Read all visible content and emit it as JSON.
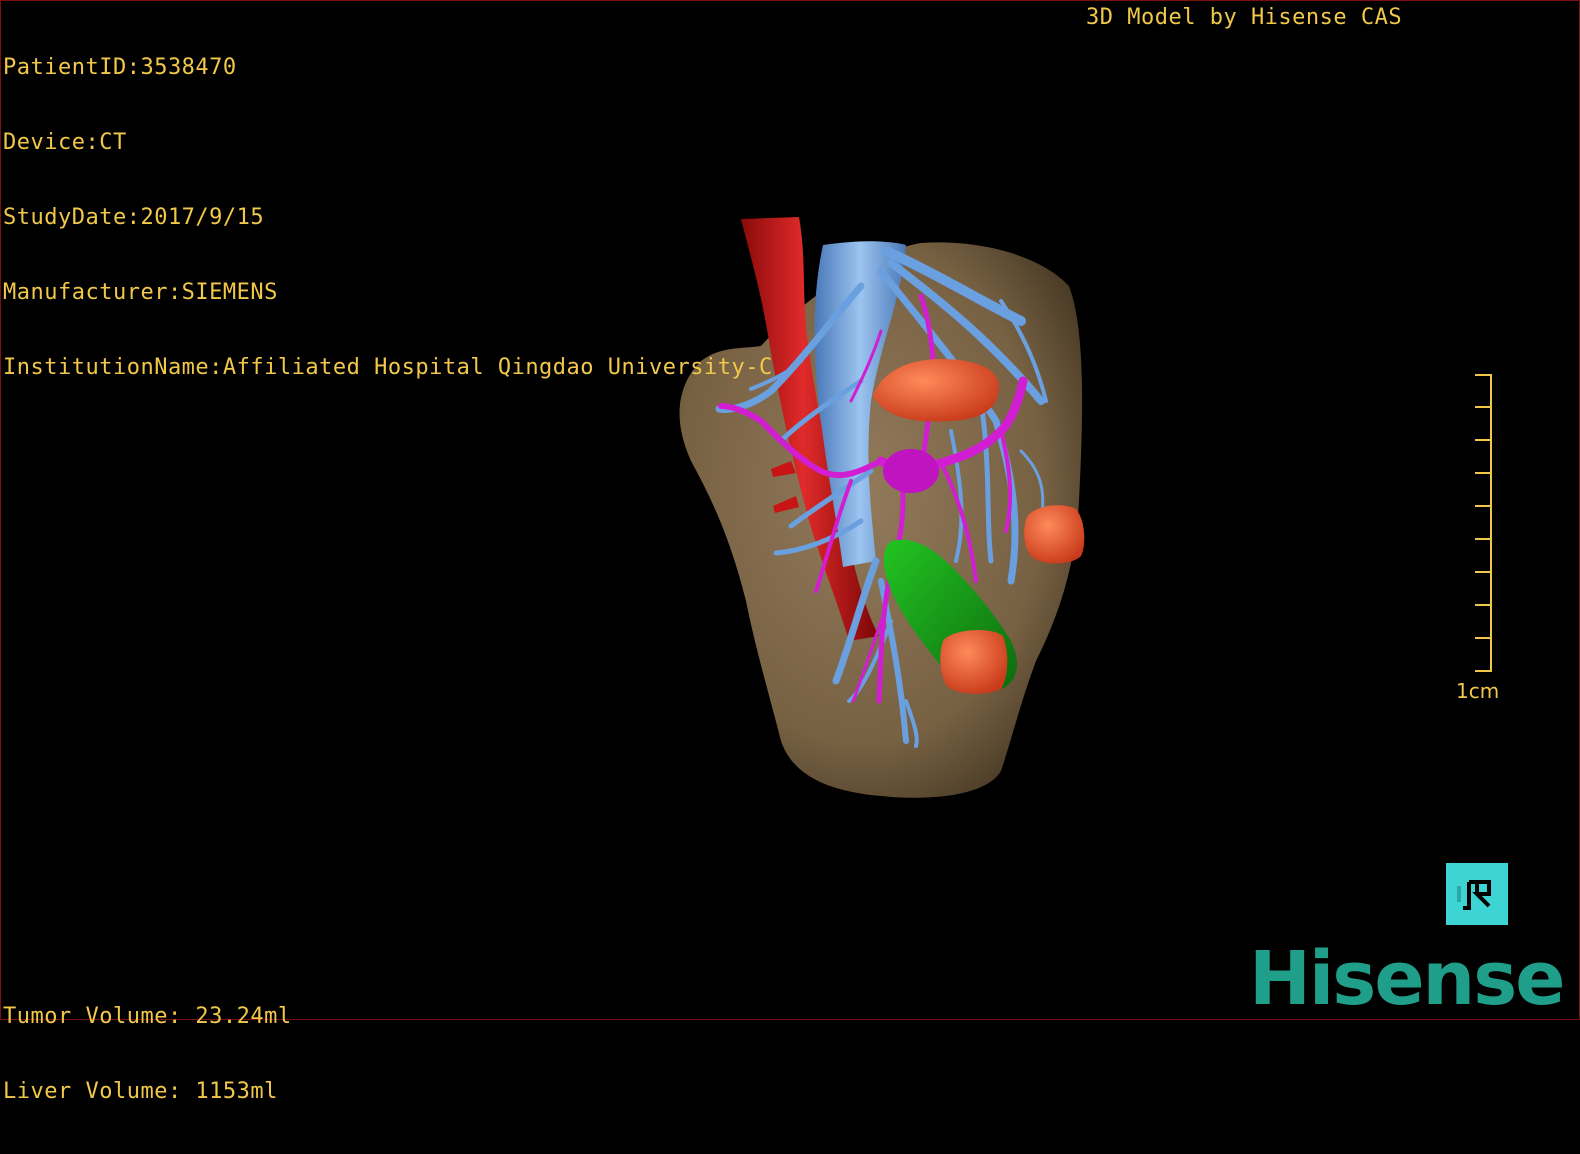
{
  "header": {
    "patient_id": "PatientID:3538470",
    "device": "Device:CT",
    "study_date": "StudyDate:2017/9/15",
    "manufacturer": "Manufacturer:SIEMENS",
    "institution": "InstitutionName:Affiliated Hospital Qingdao University-C"
  },
  "credit": "3D Model by Hisense CAS",
  "scale": {
    "label": "1cm"
  },
  "volumes": {
    "tumor": "Tumor Volume: 23.24ml",
    "liver": "Liver Volume: 1153ml"
  },
  "brand": "Hisense",
  "colors": {
    "overlay_text": "#f2c84a",
    "liver": "#8a7150",
    "vena_cava": "#c81414",
    "hepatic_vein": "#6aa0e0",
    "portal_vein": "#d21ed2",
    "tumor": "#f05a32",
    "gallbladder": "#1eaa1e",
    "brand": "#1f9e8a",
    "reset_button": "#3ed4d4"
  },
  "icons": {
    "reset_view": "reset-view-icon"
  }
}
